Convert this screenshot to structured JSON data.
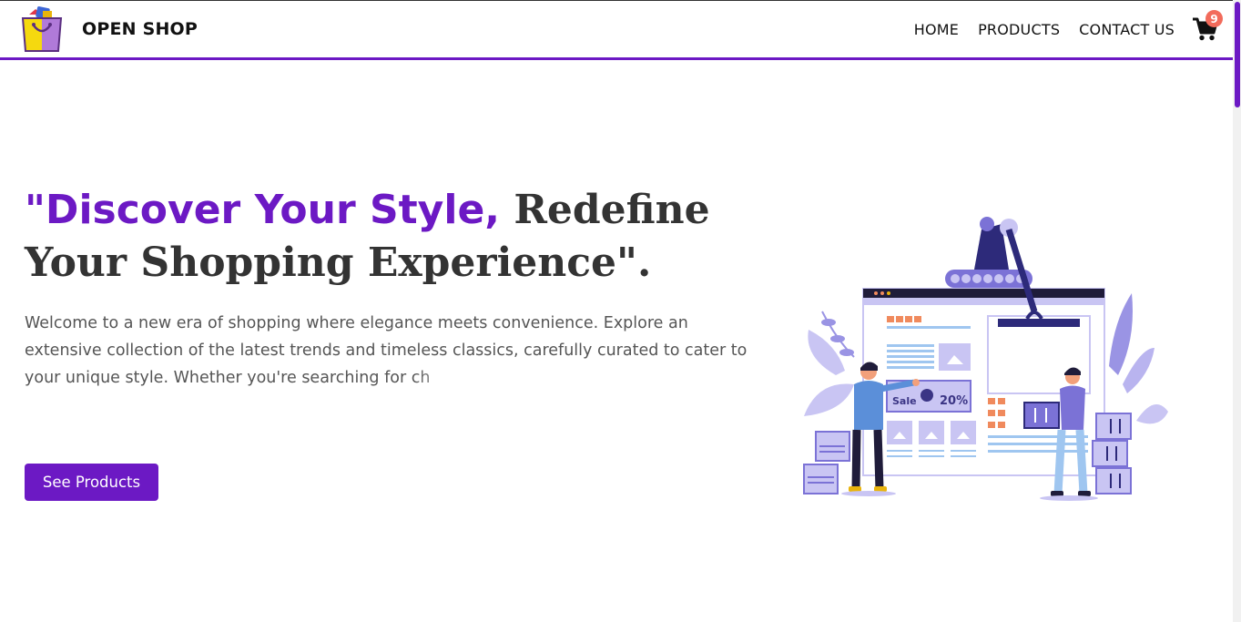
{
  "brand": {
    "name": "OPEN SHOP"
  },
  "nav": {
    "items": [
      {
        "label": "HOME"
      },
      {
        "label": "PRODUCTS"
      },
      {
        "label": "CONTACT US"
      }
    ],
    "cart_count": "9"
  },
  "hero": {
    "headline_accent": "\"Discover Your Style,",
    "headline_rest": " Redefine Your Shopping Experience\".",
    "body": "Welcome to a new era of shopping where elegance meets convenience. Explore an extensive collection of the latest trends and timeless classics, carefully curated to cater to your unique style. Whether you're searching for ch",
    "cta_label": "See Products",
    "illustration": {
      "sale_label": "Sale",
      "discount_label": "20%"
    }
  },
  "colors": {
    "accent": "#6c19c4",
    "badge": "#f26b5b",
    "illustration_primary": "#7b72d6",
    "illustration_light": "#c9c5f3"
  },
  "icons": [
    "shopping-bag-logo-icon",
    "shopping-cart-icon"
  ]
}
